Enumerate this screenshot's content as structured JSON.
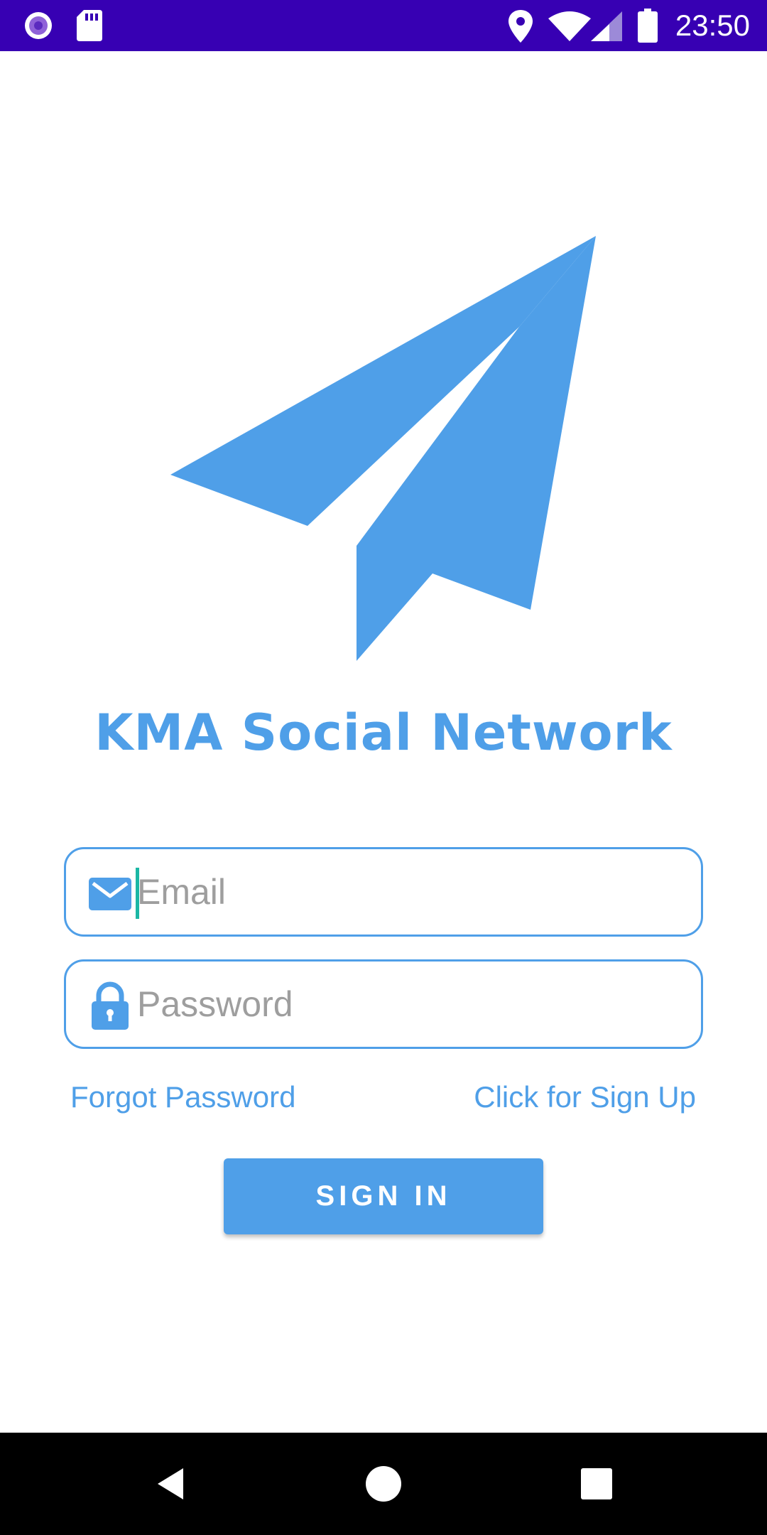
{
  "status_bar": {
    "time": "23:50",
    "icons": [
      "notification-circle-icon",
      "sd-card-icon",
      "location-icon",
      "wifi-icon",
      "cell-signal-icon",
      "battery-icon"
    ]
  },
  "app": {
    "logo_icon": "paper-plane-icon",
    "title": "KMA Social Network",
    "accent_color": "#4f9fe8"
  },
  "form": {
    "email": {
      "placeholder": "Email",
      "value": "",
      "icon": "mail-icon"
    },
    "password": {
      "placeholder": "Password",
      "value": "",
      "icon": "lock-icon"
    },
    "forgot_password": "Forgot Password",
    "sign_up": "Click for Sign Up",
    "sign_in": "SIGN IN"
  },
  "nav_bar": {
    "buttons": [
      "back-icon",
      "home-icon",
      "recents-icon"
    ]
  }
}
